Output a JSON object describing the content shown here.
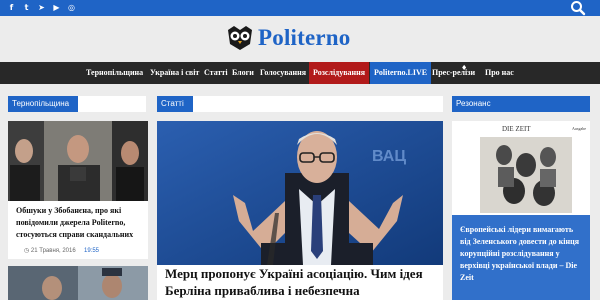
{
  "social": {
    "icons": [
      "facebook-icon",
      "twitter-icon",
      "telegram-icon",
      "youtube-icon",
      "instagram-icon"
    ],
    "glyphs": [
      "f",
      "t",
      "➤",
      "▶",
      "◎"
    ]
  },
  "header": {
    "logo_text": "Politerno"
  },
  "nav": {
    "items": [
      {
        "label": "Тернопільщина"
      },
      {
        "label": "Україна і світ"
      },
      {
        "label": "Статті"
      },
      {
        "label": "Блоги"
      },
      {
        "label": "Голосування"
      },
      {
        "label": "Розслідування"
      },
      {
        "label": "Politerno.LIVE"
      },
      {
        "label": "Прес-релізи"
      },
      {
        "label": "Про нас"
      }
    ]
  },
  "sections": {
    "left": "Тернопільщина",
    "middle": "Статті",
    "right": "Резонанс"
  },
  "left_card": {
    "title": "Обшуки у Збобанєна, про які повідомили джерела Politerno, стосуються справи скандальних",
    "date": "21 Травня, 2016",
    "time": "19:55"
  },
  "main_article": {
    "title": "Мерц пропонує Україні асоціацію. Чим ідея Берліна приваблива і небезпечна"
  },
  "resonance": {
    "title": "Європейські лідери вимагають від Зеленського довести до кінця корупційні розслідування у верхівці української влади – Die Zeit",
    "watermark": "DIE ZEIT",
    "corner_text": "Ausgabe"
  },
  "colors": {
    "accent": "#1f64c6",
    "nav_bg": "#282828",
    "nav_red": "#b21a1a"
  }
}
